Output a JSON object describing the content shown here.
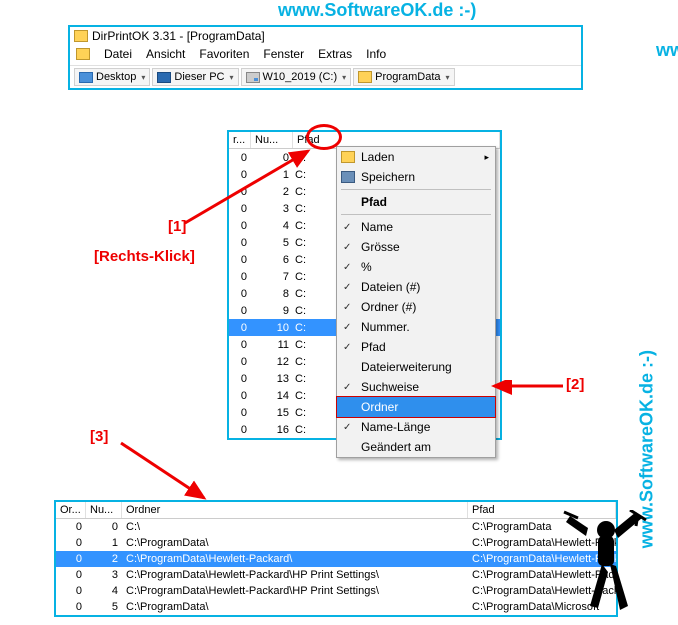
{
  "watermark": "www.SoftwareOK.de :-)",
  "watermark_partial": "www",
  "window": {
    "title": "DirPrintOK 3.31 - [ProgramData]",
    "menu": [
      "Datei",
      "Ansicht",
      "Favoriten",
      "Fenster",
      "Extras",
      "Info"
    ],
    "toolbar": {
      "desktop": "Desktop",
      "pc": "Dieser PC",
      "drive": "W10_2019 (C:)",
      "folder": "ProgramData"
    }
  },
  "annotations": {
    "rechts_klick": "[Rechts-Klick]",
    "n1": "[1]",
    "n2": "[2]",
    "n3": "[3]"
  },
  "middle": {
    "headers": {
      "r": "r...",
      "nu": "Nu...",
      "pfad": "Pfad"
    },
    "rows": [
      {
        "r": "0",
        "n": "0",
        "p": "C:"
      },
      {
        "r": "0",
        "n": "1",
        "p": "C:"
      },
      {
        "r": "0",
        "n": "2",
        "p": "C:"
      },
      {
        "r": "0",
        "n": "3",
        "p": "C:"
      },
      {
        "r": "0",
        "n": "4",
        "p": "C:"
      },
      {
        "r": "0",
        "n": "5",
        "p": "C:"
      },
      {
        "r": "0",
        "n": "6",
        "p": "C:"
      },
      {
        "r": "0",
        "n": "7",
        "p": "C:"
      },
      {
        "r": "0",
        "n": "8",
        "p": "C:"
      },
      {
        "r": "0",
        "n": "9",
        "p": "C:"
      },
      {
        "r": "0",
        "n": "10",
        "p": "C:",
        "hl": true
      },
      {
        "r": "0",
        "n": "11",
        "p": "C:"
      },
      {
        "r": "0",
        "n": "12",
        "p": "C:"
      },
      {
        "r": "0",
        "n": "13",
        "p": "C:"
      },
      {
        "r": "0",
        "n": "14",
        "p": "C:"
      },
      {
        "r": "0",
        "n": "15",
        "p": "C:"
      },
      {
        "r": "0",
        "n": "16",
        "p": "C:"
      }
    ]
  },
  "context_menu": {
    "laden": "Laden",
    "speichern": "Speichern",
    "pfad_bold": "Pfad",
    "items": [
      {
        "label": "Name",
        "checked": true
      },
      {
        "label": "Grösse",
        "checked": true
      },
      {
        "label": "%",
        "checked": true
      },
      {
        "label": "Dateien (#)",
        "checked": true
      },
      {
        "label": "Ordner (#)",
        "checked": true
      },
      {
        "label": "Nummer.",
        "checked": true
      },
      {
        "label": "Pfad",
        "checked": true
      },
      {
        "label": "Dateierweiterung",
        "checked": false
      },
      {
        "label": "Suchweise",
        "checked": true
      },
      {
        "label": "Ordner",
        "checked": false,
        "highlight": true
      },
      {
        "label": "Name-Länge",
        "checked": true
      },
      {
        "label": "Geändert am",
        "checked": false
      }
    ]
  },
  "bottom": {
    "headers": {
      "or": "Or...",
      "nu": "Nu...",
      "ordner": "Ordner",
      "pfad": "Pfad"
    },
    "rows": [
      {
        "or": "0",
        "nu": "0",
        "ordner": "C:\\",
        "pfad": "C:\\ProgramData"
      },
      {
        "or": "0",
        "nu": "1",
        "ordner": "C:\\ProgramData\\",
        "pfad": "C:\\ProgramData\\Hewlett-Pack"
      },
      {
        "or": "0",
        "nu": "2",
        "ordner": "C:\\ProgramData\\Hewlett-Packard\\",
        "pfad": "C:\\ProgramData\\Hewlett-Pack",
        "hl": true
      },
      {
        "or": "0",
        "nu": "3",
        "ordner": "C:\\ProgramData\\Hewlett-Packard\\HP Print Settings\\",
        "pfad": "C:\\ProgramData\\Hewlett-Pack"
      },
      {
        "or": "0",
        "nu": "4",
        "ordner": "C:\\ProgramData\\Hewlett-Packard\\HP Print Settings\\",
        "pfad": "C:\\ProgramData\\Hewlett-Pack"
      },
      {
        "or": "0",
        "nu": "5",
        "ordner": "C:\\ProgramData\\",
        "pfad": "C:\\ProgramData\\Microsoft"
      }
    ]
  }
}
